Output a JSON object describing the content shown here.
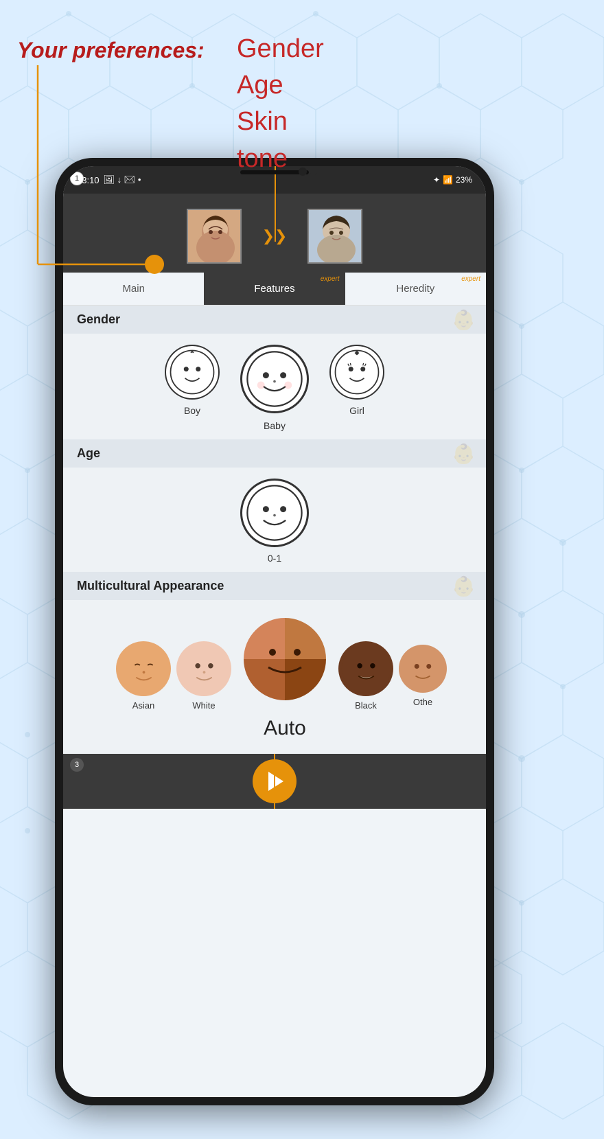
{
  "annotation": {
    "preferences_label": "Your preferences:",
    "categories": [
      "Gender",
      "Age",
      "Skin tone"
    ]
  },
  "status_bar": {
    "time": "13:10",
    "battery": "23%",
    "signal": "●"
  },
  "tabs": [
    {
      "id": "main",
      "label": "Main",
      "active": false
    },
    {
      "id": "features",
      "label": "Features",
      "active": true,
      "expert": "expert"
    },
    {
      "id": "heredity",
      "label": "Heredity",
      "active": false,
      "expert": "expert"
    }
  ],
  "badges": {
    "top": "1",
    "bottom": "3"
  },
  "sections": {
    "gender": {
      "title": "Gender",
      "items": [
        {
          "id": "boy",
          "label": "Boy"
        },
        {
          "id": "baby",
          "label": "Baby"
        },
        {
          "id": "girl",
          "label": "Girl"
        }
      ]
    },
    "age": {
      "title": "Age",
      "items": [
        {
          "id": "age-0-1",
          "label": "0-1"
        }
      ]
    },
    "multicultural": {
      "title": "Multicultural Appearance",
      "items": [
        {
          "id": "asian",
          "label": "Asian",
          "color": "#e8a870"
        },
        {
          "id": "white",
          "label": "White",
          "color": "#f0c8b4"
        },
        {
          "id": "auto",
          "label": "Auto",
          "color": "mixed"
        },
        {
          "id": "black",
          "label": "Black",
          "color": "#6b3a1f"
        },
        {
          "id": "other",
          "label": "Othe",
          "color": "#d4956a"
        }
      ],
      "selected": "Auto"
    }
  },
  "bottom": {
    "play_label": "▶"
  }
}
